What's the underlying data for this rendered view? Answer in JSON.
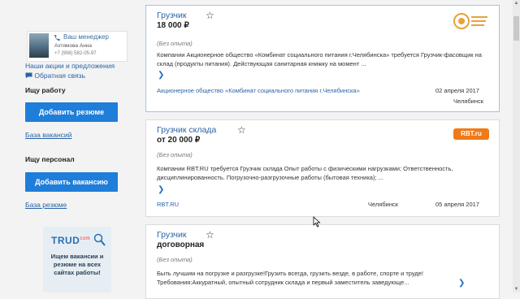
{
  "manager": {
    "title": "Ваш менеджер",
    "name": "Ахтямова Анна",
    "phone": "+7 (908) 582-05-97"
  },
  "sidebar": {
    "promotions_link": "Наши акции и предложения",
    "feedback_link": "Обратная связь",
    "job_search_heading": "Ищу работу",
    "add_resume_button": "Добавить резюме",
    "vacancies_db_link": "База вакансий",
    "staff_search_heading": "Ищу персонал",
    "add_vacancy_button": "Добавить вакансию",
    "resume_db_link": "База резюме"
  },
  "banner": {
    "logo_text": "TRUD",
    "logo_sup": "com",
    "text": "Ищем вакансии и резюме на всех сайтах работы!"
  },
  "vacancies": [
    {
      "title": "Грузчик",
      "salary": "18 000 ₽",
      "experience": "(Без опыта)",
      "description": "Компании Акционерное общество «Комбинат социального питания г.Челябинска» требуется Грузчик-фасовщик на склад (продукты питания). Действующая санитарная книжку на момент ...",
      "company": "Акционерное общество «Комбинат социального питания г.Челябинска»",
      "date": "02 апреля 2017",
      "city": "Челябинск"
    },
    {
      "title": "Грузчик склада",
      "salary": "от 20 000 ₽",
      "experience": "(Без опыта)",
      "description": "Компании RBT.RU требуется Грузчик склада Опыт работы с физическими нагрузками; Ответственность, дисциплинированность. Погрузочно-разгрузочные работы (бытовая техника); ...",
      "company": "RBT.RU",
      "city": "Челябинск",
      "date": "05 апреля 2017",
      "logo_text": "RBT.ru"
    },
    {
      "title": "Грузчик",
      "salary": "договорная",
      "experience": "(Без опыта)",
      "description": "Быть лучшим на погрузке и разгрузке!Грузить всегда, грузить везде, в работе, спорте и труде! Требования:Аккуратный, опытный сотрудник склада и первый заместитель заведующе..."
    }
  ],
  "icons": {
    "star": "star-icon",
    "arrow": "chevron-right-icon",
    "phone": "phone-icon",
    "chat": "chat-icon"
  },
  "colors": {
    "link": "#2a64a6",
    "button": "#1f7ed9",
    "rbt_orange": "#f07a1a"
  }
}
